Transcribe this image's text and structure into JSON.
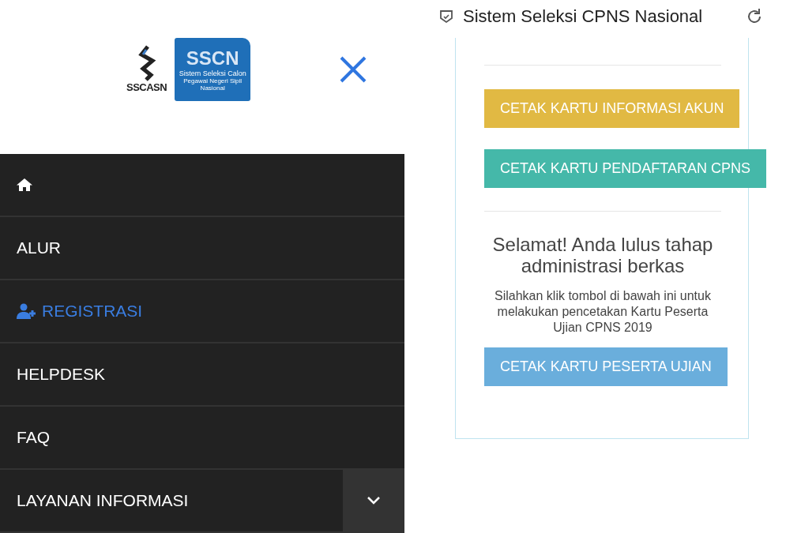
{
  "logo": {
    "left_text": "SSCASN",
    "right_title": "SSCN",
    "right_subtitle": "Sistem Seleksi Calon",
    "right_caption": "Pegawai Negeri Sipil Nasional"
  },
  "menu": [
    {
      "kind": "home",
      "selected": false
    },
    {
      "kind": "text",
      "label": "ALUR",
      "selected": false
    },
    {
      "kind": "register",
      "label": "REGISTRASI",
      "selected": true
    },
    {
      "kind": "text",
      "label": "HELPDESK",
      "selected": false
    },
    {
      "kind": "text",
      "label": "FAQ",
      "selected": false
    },
    {
      "kind": "submenu",
      "label": "LAYANAN INFORMASI",
      "selected": false,
      "expanded": false
    }
  ],
  "browser_bar": {
    "title": "Sistem Seleksi CPNS Nasional"
  },
  "card": {
    "buttons_top": [
      {
        "label": "CETAK KARTU INFORMASI AKUN",
        "color": "#e1b943"
      },
      {
        "label": "CETAK KARTU PENDAFTARAN CPNS",
        "color": "#45b8a9"
      }
    ],
    "heading": "Selamat! Anda lulus tahap administrasi berkas",
    "message": "Silahkan klik tombol di bawah ini untuk melakukan pencetakan Kartu Peserta Ujian CPNS 2019",
    "button_bottom": {
      "label": "CETAK KARTU PESERTA UJIAN",
      "color": "#6aaedc"
    }
  }
}
